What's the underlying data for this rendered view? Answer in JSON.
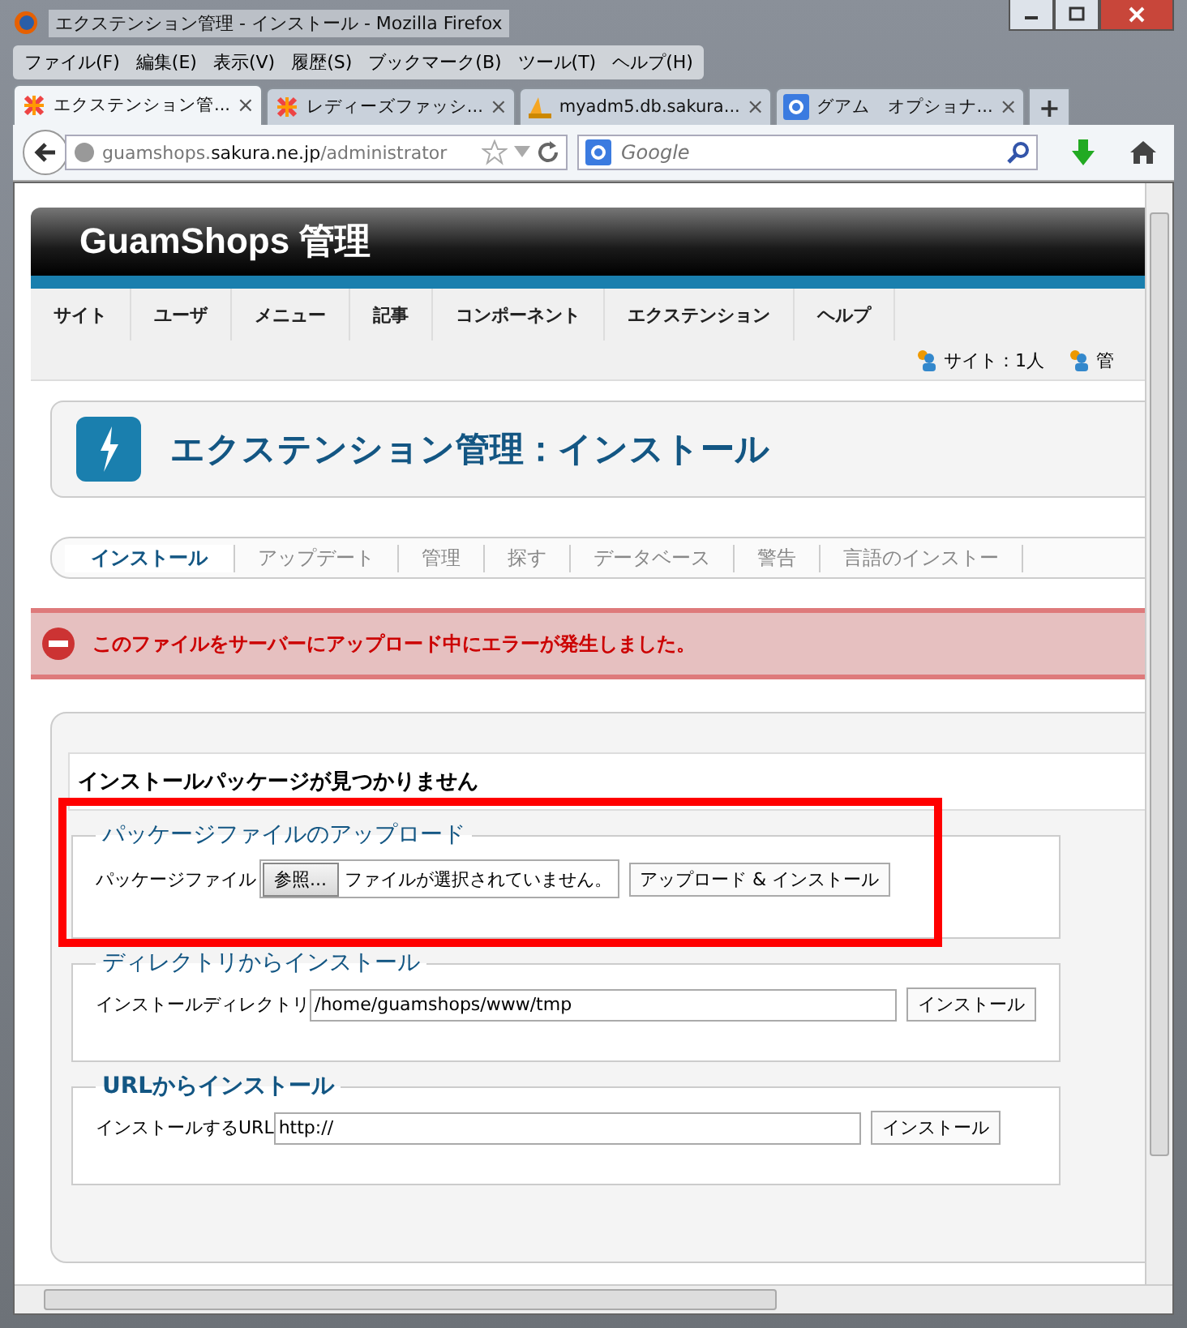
{
  "window": {
    "title": "エクステンション管理 - インストール - Mozilla Firefox"
  },
  "menu_bar": [
    "ファイル(F)",
    "編集(E)",
    "表示(V)",
    "履歴(S)",
    "ブックマーク(B)",
    "ツール(T)",
    "ヘルプ(H)"
  ],
  "tabs": [
    {
      "label": "エクステンション管...",
      "selected": true,
      "kind": "joomla",
      "close": "×"
    },
    {
      "label": "レディーズファッシ...",
      "selected": false,
      "kind": "joomla",
      "close": "×"
    },
    {
      "label": "myadm5.db.sakura...",
      "selected": false,
      "kind": "pma",
      "close": "×"
    },
    {
      "label": "グアム　オプショナ...",
      "selected": false,
      "kind": "google",
      "close": "×"
    }
  ],
  "new_tab": "+",
  "address_bar": {
    "prefix": "guamshops.",
    "domain": "sakura.ne.jp",
    "path": "/administrator"
  },
  "search_bar": {
    "placeholder": "Google"
  },
  "page": {
    "site_title": "GuamShops 管理",
    "nav": [
      "サイト",
      "ユーザ",
      "メニュー",
      "記事",
      "コンポーネント",
      "エクステンション",
      "ヘルプ"
    ],
    "status": [
      "サイト：1人",
      "管"
    ],
    "toolbar_title": "エクステンション管理：インストール",
    "subtabs": [
      {
        "label": "インストール",
        "selected": true
      },
      {
        "label": "アップデート",
        "selected": false
      },
      {
        "label": "管理",
        "selected": false
      },
      {
        "label": "探す",
        "selected": false
      },
      {
        "label": "データベース",
        "selected": false
      },
      {
        "label": "警告",
        "selected": false
      },
      {
        "label": "言語のインストー",
        "selected": false
      }
    ],
    "error": "このファイルをサーバーにアップロード中にエラーが発生しました。",
    "section_heading": "インストールパッケージが見つかりません",
    "fieldsets": [
      {
        "kind": "file",
        "legend": "パッケージファイルのアップロード",
        "label": "パッケージファイル",
        "browse": "参照...",
        "file_status": "ファイルが選択されていません。",
        "submit": "アップロード & インストール",
        "highlighted": true
      },
      {
        "kind": "text",
        "legend": "ディレクトリからインストール",
        "label": "インストールディレクトリ",
        "value": "/home/guamshops/www/tmp",
        "submit": "インストール",
        "highlighted": false
      },
      {
        "kind": "text",
        "legend": "URLからインストール",
        "label": "インストールするURL",
        "value": "http://",
        "submit": "インストール",
        "highlighted": false
      }
    ]
  }
}
